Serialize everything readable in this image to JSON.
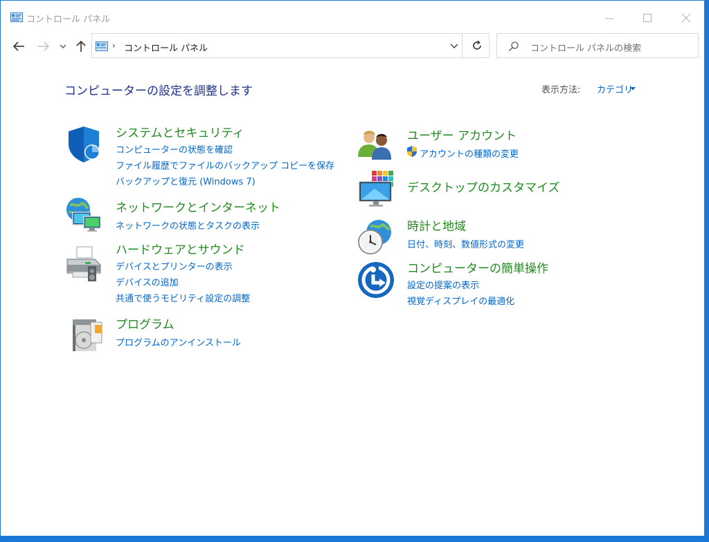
{
  "window": {
    "title": "コントロール パネル",
    "controls": [
      "minimize",
      "maximize",
      "close"
    ]
  },
  "navigation": {
    "back_icon": "arrow-left-icon",
    "forward_icon": "arrow-right-icon",
    "recent_icon": "chevron-down-icon",
    "up_icon": "arrow-up-icon"
  },
  "address": {
    "separator": "›",
    "path": "コントロール パネル",
    "refresh_icon": "refresh-icon"
  },
  "search": {
    "placeholder": "コントロール パネルの検索"
  },
  "header": {
    "title": "コンピューターの設定を調整します",
    "view_by_label": "表示方法:",
    "view_by_value": "カテゴリ"
  },
  "categories": {
    "system": {
      "icon": "shield-icon",
      "title": "システムとセキュリティ",
      "links": [
        "コンピューターの状態を確認",
        "ファイル履歴でファイルのバックアップ コピーを保存",
        "バックアップと復元 (Windows 7)"
      ]
    },
    "network": {
      "icon": "network-globe-icon",
      "title": "ネットワークとインターネット",
      "links": [
        "ネットワークの状態とタスクの表示"
      ]
    },
    "hardware": {
      "icon": "printer-icon",
      "title": "ハードウェアとサウンド",
      "links": [
        "デバイスとプリンターの表示",
        "デバイスの追加",
        "共通で使うモビリティ設定の調整"
      ]
    },
    "programs": {
      "icon": "programs-disc-icon",
      "title": "プログラム",
      "links": [
        "プログラムのアンインストール"
      ]
    },
    "users": {
      "icon": "users-icon",
      "title": "ユーザー アカウント",
      "links": [
        "アカウントの種類の変更"
      ],
      "link_icon": "uac-shield-icon"
    },
    "appearance": {
      "icon": "desktop-color-icon",
      "title": "デスクトップのカスタマイズ",
      "links": []
    },
    "clock": {
      "icon": "clock-globe-icon",
      "title": "時計と地域",
      "links": [
        "日付、時刻、数値形式の変更"
      ]
    },
    "ease": {
      "icon": "ease-of-access-icon",
      "title": "コンピューターの簡単操作",
      "links": [
        "設定の提案の表示",
        "視覚ディスプレイの最適化"
      ]
    }
  },
  "colors": {
    "accent": "#1a78d8",
    "category_title": "#1f8a1f",
    "link": "#0066cc",
    "page_title": "#1e3287"
  }
}
